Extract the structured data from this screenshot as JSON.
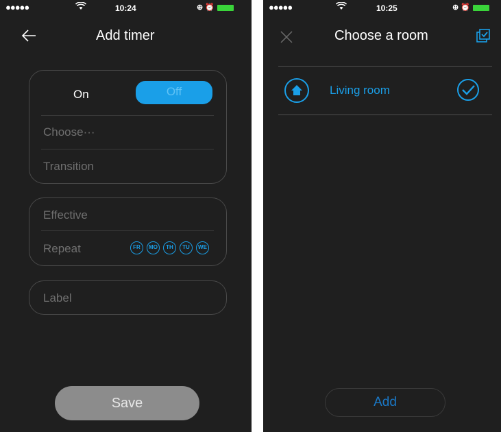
{
  "left_screen": {
    "status": {
      "signal": "●●●●●",
      "time": "10:24",
      "icons": "⊕ ⏰"
    },
    "title": "Add timer",
    "power": {
      "on_label": "On",
      "off_label": "Off"
    },
    "rows": {
      "choose": "Choose···",
      "transition": "Transition",
      "effective": "Effective",
      "repeat": "Repeat",
      "label": "Label"
    },
    "repeat_days": [
      "FR",
      "MO",
      "TH",
      "TU",
      "WE"
    ],
    "save_label": "Save"
  },
  "right_screen": {
    "status": {
      "signal": "●●●●●",
      "time": "10:25",
      "icons": "⊕ ⏰"
    },
    "title": "Choose a room",
    "rooms": [
      {
        "name": "Living room",
        "selected": true
      }
    ],
    "add_label": "Add"
  },
  "colors": {
    "background": "#1f1f1f",
    "accent": "#1a9fe8",
    "muted_text": "#6f6f6f",
    "save_button": "#8c8c8c"
  }
}
